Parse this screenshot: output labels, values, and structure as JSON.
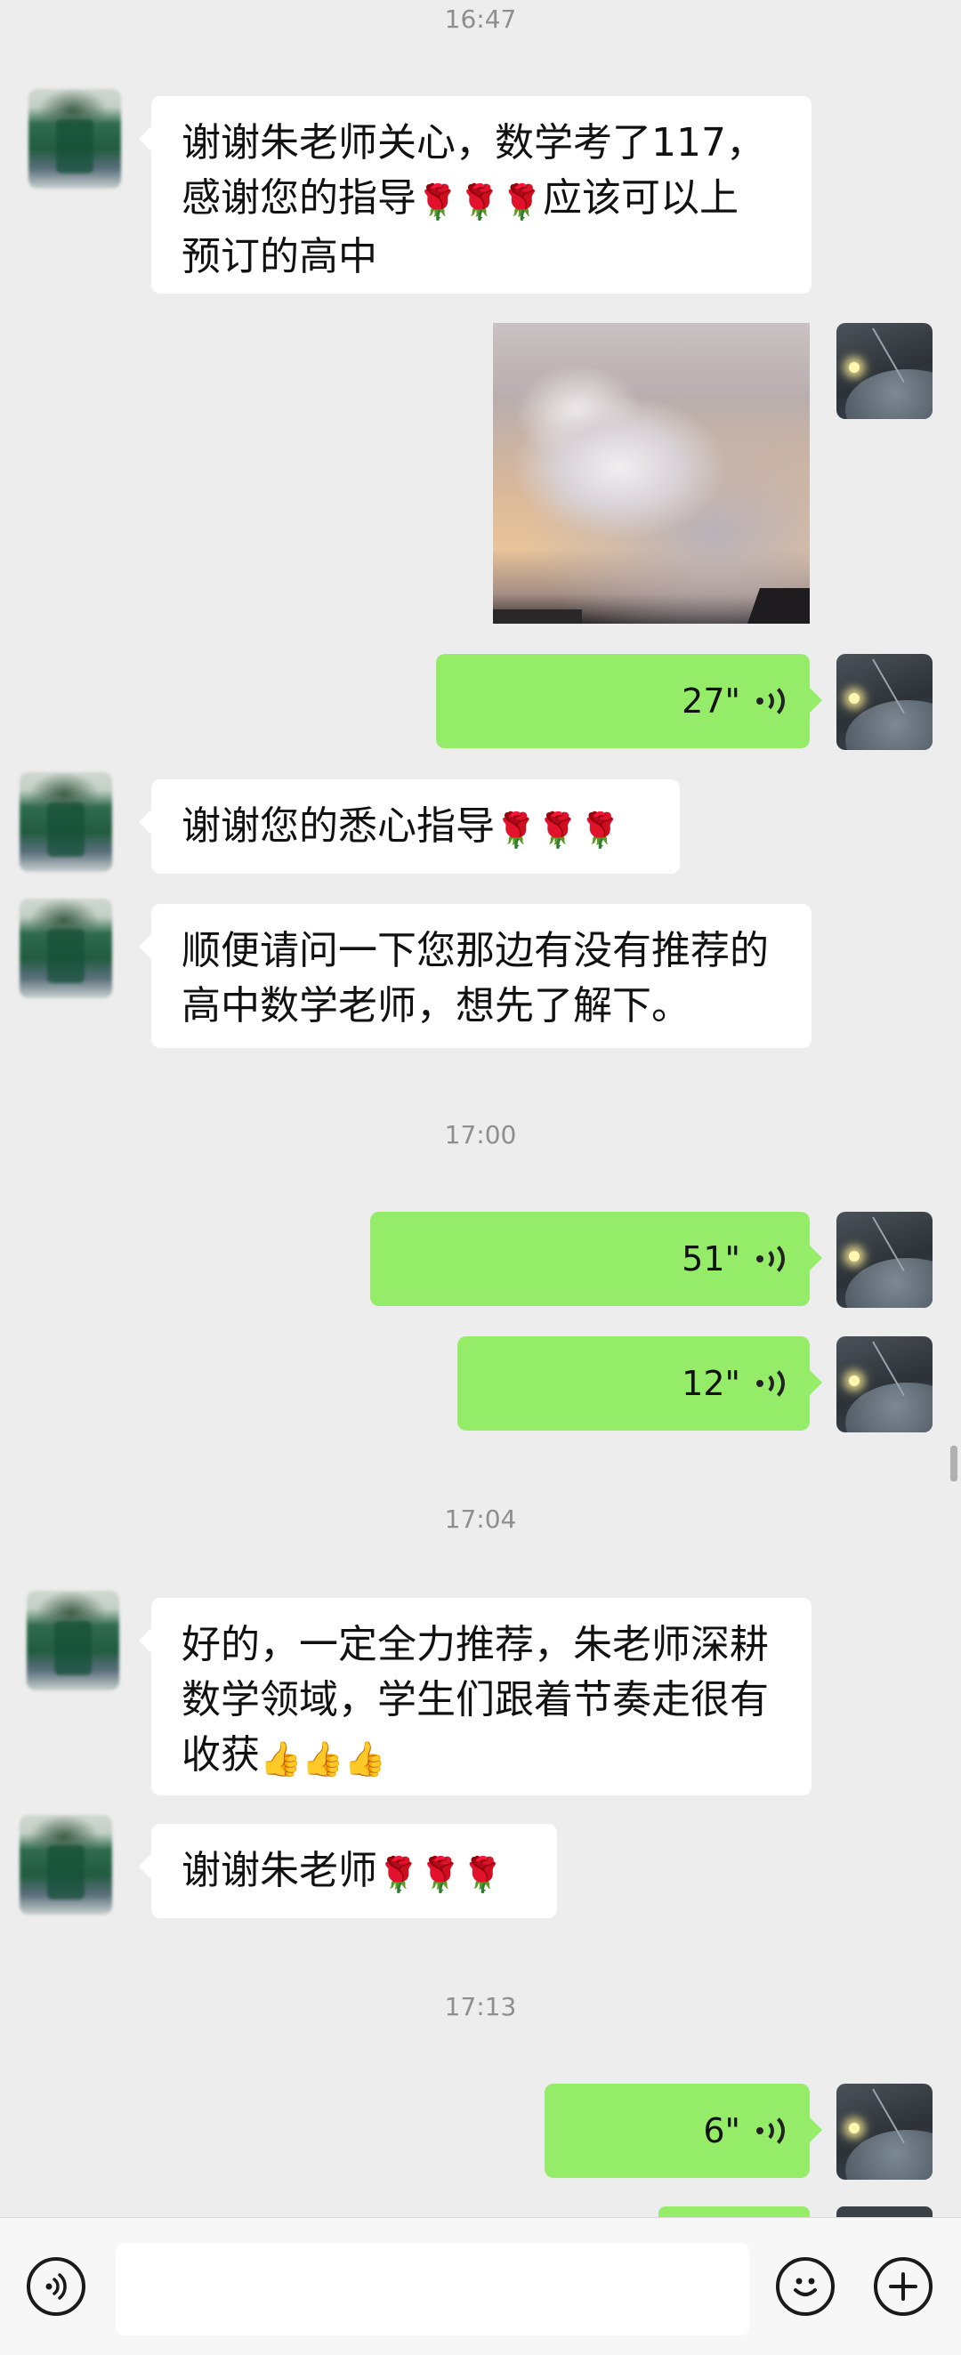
{
  "timestamps": [
    "16:47",
    "17:00",
    "17:04",
    "17:13"
  ],
  "messages": {
    "m1": {
      "text": "谢谢朱老师关心，数学考了117，",
      "line2_text": "感谢您的指导",
      "line2_suffix": "应该可以上",
      "line3": "预订的高中"
    },
    "voice1": "27\"",
    "m2": {
      "text": "谢谢您的悉心指导"
    },
    "m3": {
      "line1": "顺便请问一下您那边有没有推荐的",
      "line2": "高中数学老师，想先了解下。"
    },
    "voice2": "51\"",
    "voice3": "12\"",
    "m4": {
      "line1": "好的，一定全力推荐，朱老师深耕",
      "line2": "数学领域，学生们跟着节奏走很有",
      "line3": "收获"
    },
    "m5": {
      "text": "谢谢朱老师"
    },
    "voice4": "6\""
  },
  "icons": {
    "rose": "🌹",
    "thumbs_up": "👍",
    "voice_toggle": "voice-icon",
    "emoji": "emoji-icon",
    "plus": "plus-icon"
  },
  "colors": {
    "background": "#ededed",
    "outgoing_bubble": "#95ec69",
    "incoming_bubble": "#ffffff",
    "timestamp": "#8e8e8e"
  }
}
